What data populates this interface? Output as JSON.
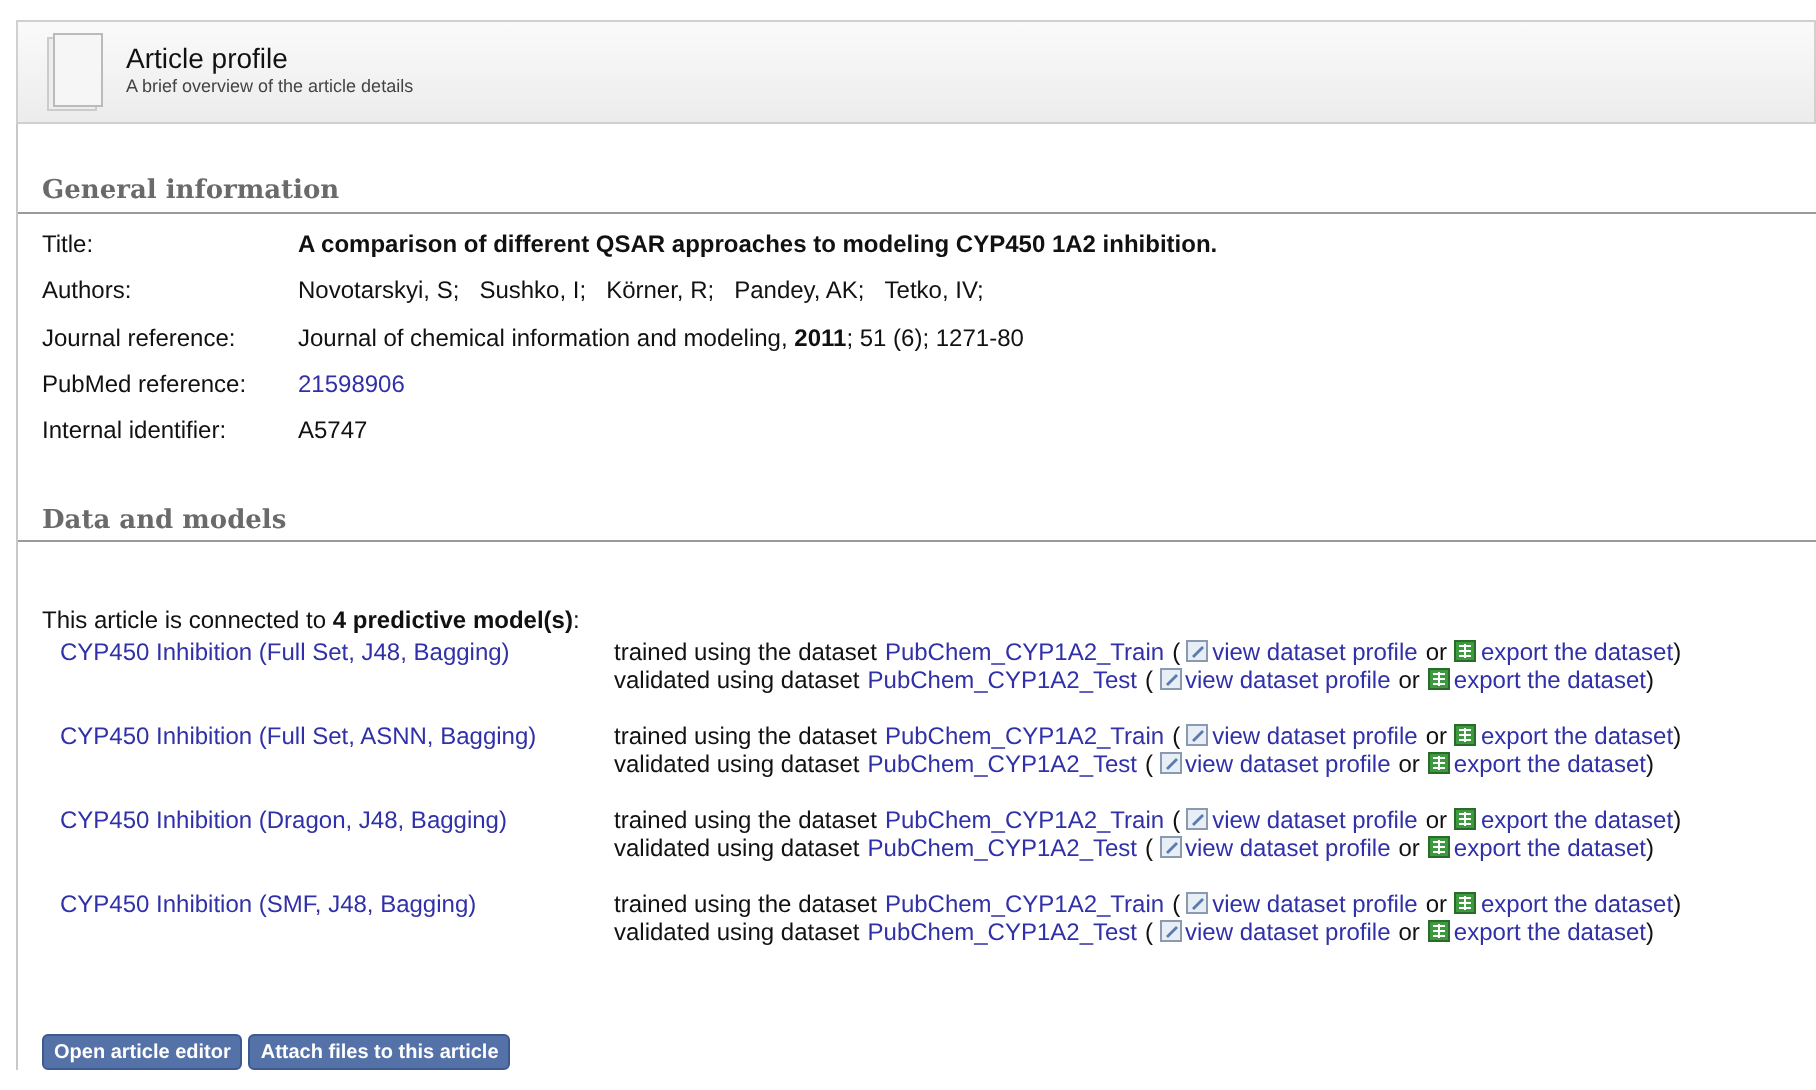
{
  "header": {
    "title": "Article profile",
    "subtitle": "A brief overview of the article details"
  },
  "general": {
    "heading": "General information",
    "rows": [
      {
        "label": "Title:",
        "kind": "title",
        "value": "A comparison of different QSAR approaches to modeling CYP450 1A2 inhibition."
      },
      {
        "label": "Authors:",
        "kind": "authors",
        "authors": [
          "Novotarskyi, S;",
          "Sushko, I;",
          "Körner, R;",
          "Pandey, AK;",
          "Tetko, IV;"
        ]
      },
      {
        "label": "Journal reference:",
        "kind": "text",
        "value": "Journal of chemical information and modeling, **2011**; 51 (6); 1271-80"
      },
      {
        "label": "PubMed reference:",
        "kind": "link",
        "value": "21598906"
      },
      {
        "label": "Internal identifier:",
        "kind": "text",
        "value": "A5747"
      }
    ]
  },
  "data": {
    "heading": "Data and models",
    "intro": "This article is connected to **4 predictive model(s)**:",
    "models": [
      {
        "name": "CYP450 Inhibition (Full Set, J48, Bagging)",
        "lines": [
          {
            "text": "trained using the dataset",
            "dataset": "PubChem_CYP1A2_Train",
            "open": "(",
            "view": "view dataset profile",
            "or": "or",
            "export": "export the dataset",
            "close": ")"
          },
          {
            "text": "validated using dataset",
            "dataset": "PubChem_CYP1A2_Test",
            "open": "(",
            "view": "view dataset profile",
            "or": "or",
            "export": "export the dataset",
            "close": ")"
          }
        ]
      },
      {
        "name": "CYP450 Inhibition (Full Set, ASNN, Bagging)",
        "lines": [
          {
            "text": "trained using the dataset",
            "dataset": "PubChem_CYP1A2_Train",
            "open": "(",
            "view": "view dataset profile",
            "or": "or",
            "export": "export the dataset",
            "close": ")"
          },
          {
            "text": "validated using dataset",
            "dataset": "PubChem_CYP1A2_Test",
            "open": "(",
            "view": "view dataset profile",
            "or": "or",
            "export": "export the dataset",
            "close": ")"
          }
        ]
      },
      {
        "name": "CYP450 Inhibition (Dragon, J48, Bagging)",
        "lines": [
          {
            "text": "trained using the dataset",
            "dataset": "PubChem_CYP1A2_Train",
            "open": "(",
            "view": "view dataset profile",
            "or": "or",
            "export": "export the dataset",
            "close": ")"
          },
          {
            "text": "validated using dataset",
            "dataset": "PubChem_CYP1A2_Test",
            "open": "(",
            "view": "view dataset profile",
            "or": "or",
            "export": "export the dataset",
            "close": ")"
          }
        ]
      },
      {
        "name": "CYP450 Inhibition (SMF, J48, Bagging)",
        "lines": [
          {
            "text": "trained using the dataset",
            "dataset": "PubChem_CYP1A2_Train",
            "open": "(",
            "view": "view dataset profile",
            "or": "or",
            "export": "export the dataset",
            "close": ")"
          },
          {
            "text": "validated using dataset",
            "dataset": "PubChem_CYP1A2_Test",
            "open": "(",
            "view": "view dataset profile",
            "or": "or",
            "export": "export the dataset",
            "close": ")"
          }
        ]
      }
    ]
  },
  "buttons": [
    "Open article editor",
    "Attach files to this article"
  ]
}
